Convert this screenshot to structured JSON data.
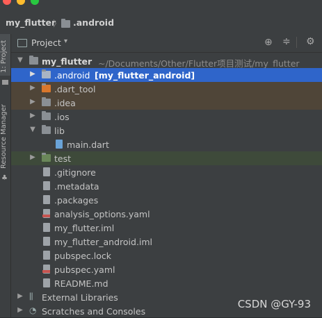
{
  "nav": {
    "project_crumb": "my_flutter",
    "folder_crumb": ".android"
  },
  "left_strip": {
    "project_tab": "1: Project",
    "resource_tab": "Resource Manager"
  },
  "panel": {
    "title": "Project"
  },
  "tree": {
    "root": {
      "name": "my_flutter",
      "path": "~/Documents/Other/Flutter项目测试/my_flutter"
    },
    "items": [
      {
        "label": ".android",
        "module": "[my_flutter_android]"
      },
      {
        "label": ".dart_tool"
      },
      {
        "label": ".idea"
      },
      {
        "label": ".ios"
      },
      {
        "label": "lib"
      },
      {
        "label": "main.dart"
      },
      {
        "label": "test"
      },
      {
        "label": ".gitignore"
      },
      {
        "label": ".metadata"
      },
      {
        "label": ".packages"
      },
      {
        "label": "analysis_options.yaml"
      },
      {
        "label": "my_flutter.iml"
      },
      {
        "label": "my_flutter_android.iml"
      },
      {
        "label": "pubspec.lock"
      },
      {
        "label": "pubspec.yaml"
      },
      {
        "label": "README.md"
      },
      {
        "label": "External Libraries"
      },
      {
        "label": "Scratches and Consoles"
      }
    ]
  },
  "watermark": "CSDN @GY-93",
  "colors": {
    "selection": "#2f65ca",
    "excluded_folder": "#4f4538",
    "test_folder": "#3e4a3a",
    "background": "#3c3f41"
  }
}
